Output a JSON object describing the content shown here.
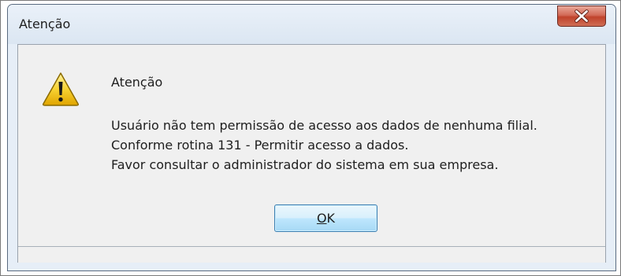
{
  "window": {
    "title": "Atenção",
    "close_icon": "close-icon"
  },
  "message": {
    "icon": "warning-icon",
    "title": "Atenção",
    "lines": [
      "Usuário não tem permissão de acesso aos dados de nenhuma filial.",
      "Conforme rotina 131 - Permitir acesso a dados.",
      "Favor consultar o administrador do sistema em sua empresa."
    ]
  },
  "buttons": {
    "ok_mnemonic": "O",
    "ok_rest": "K"
  },
  "colors": {
    "close_button": "#c7452f",
    "warning_yellow": "#f5c400",
    "ok_button_border": "#3c7fb1"
  }
}
